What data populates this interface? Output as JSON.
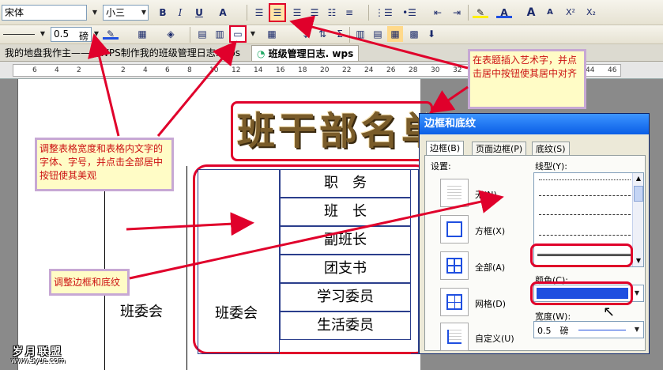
{
  "toolbar1": {
    "font_name": "宋体",
    "font_size": "小三",
    "bold": "B",
    "italic": "I",
    "underline": "U",
    "char_shading": "A",
    "grow_font": "A",
    "shrink_font": "A",
    "superscript": "X²",
    "subscript": "X₂"
  },
  "toolbar2": {
    "line_width_value": "0.5",
    "line_width_unit": "磅"
  },
  "tabs": [
    {
      "label": "我的地盘我作主——用WPS制作我的班级管理日志. wps"
    },
    {
      "label": "班级管理日志. wps"
    }
  ],
  "ruler": {
    "ticks": [
      "6",
      "4",
      "2",
      "",
      "2",
      "4",
      "6",
      "8",
      "10",
      "12",
      "14",
      "16",
      "18",
      "20",
      "22",
      "24",
      "26",
      "28",
      "30",
      "32",
      "34",
      "36",
      "38",
      "40",
      "42",
      "44",
      "46"
    ]
  },
  "document": {
    "art_title": "班干部名单",
    "side_label": "班委会",
    "group_label": "班委会",
    "header_cell": "职　务",
    "rows": [
      "班　长",
      "副班长",
      "团支书",
      "学习委员",
      "生活委员"
    ]
  },
  "callouts": {
    "top_right": "在表题插入艺术字，并点击居中按钮使其居中对齐",
    "left": "调整表格宽度和表格内文字的字体、字号，并点击全部居中按钮使其美观",
    "bottom": "调整边框和底纹"
  },
  "dialog": {
    "title": "边框和底纹",
    "tabs": [
      "边框(B)",
      "页面边框(P)",
      "底纹(S)"
    ],
    "settings_label": "设置:",
    "presets": [
      "无(N)",
      "方框(X)",
      "全部(A)",
      "网格(D)",
      "自定义(U)"
    ],
    "line_style_label": "线型(Y):",
    "color_label": "颜色(C):",
    "color_value": "#1f4fe0",
    "width_label": "宽度(W):",
    "width_value": "0.5　磅"
  },
  "watermark": {
    "brand": "岁月联盟",
    "url": "www.Syue.com"
  },
  "colors": {
    "highlight_red": "#e0002b",
    "callout_border": "#c7a8d4",
    "callout_text": "#c11111",
    "line_blue": "#1f4fe0"
  }
}
